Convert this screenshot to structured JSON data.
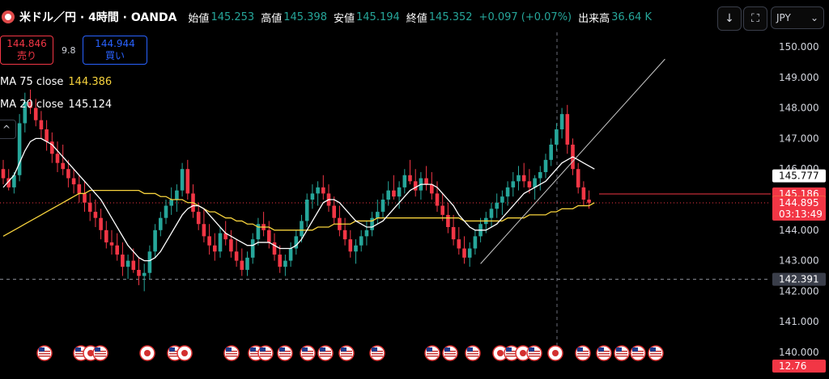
{
  "header": {
    "symbol": "米ドル／円 · 4時間 · OANDA",
    "open_label": "始値",
    "open": "145.253",
    "high_label": "高値",
    "high": "145.398",
    "low_label": "安値",
    "low": "145.194",
    "close_label": "終値",
    "close": "145.352",
    "change": "+0.097 (+0.07%)",
    "volume_label": "出来高",
    "volume": "36.64 K",
    "currency": "JPY",
    "icons": [
      "download-icon",
      "fullscreen-icon",
      "chevron-down-icon"
    ]
  },
  "trade": {
    "sell_price": "144.846",
    "sell_label": "売り",
    "spread": "9.8",
    "buy_price": "144.944",
    "buy_label": "買い"
  },
  "indicators": [
    {
      "name": "MA 75 close",
      "value": "144.386",
      "color": "#f7d33d"
    },
    {
      "name": "MA 20 close",
      "value": "145.124",
      "color": "#ffffff"
    }
  ],
  "colors": {
    "up": "#26a69a",
    "down": "#f23645",
    "ma75": "#f7d33d",
    "ma20": "#ffffff",
    "trend": "#c8c8c8"
  },
  "chart_data": {
    "type": "candlestick",
    "y_ticks": [
      "150.000",
      "149.000",
      "148.000",
      "147.000",
      "146.000",
      "145.000",
      "144.000",
      "143.000",
      "142.000",
      "141.000",
      "140.000"
    ],
    "ylim": [
      139.7,
      150.35
    ],
    "price_labels": [
      {
        "text": "145.777",
        "value": 145.777,
        "bg": "#ffffff",
        "fg": "#000000"
      },
      {
        "text": "145.186",
        "value": 145.186,
        "bg": "#f23645",
        "fg": "#ffffff"
      },
      {
        "text": "144.902",
        "value": 144.902,
        "bg": "#f7d33d",
        "fg": "#000000"
      },
      {
        "text": "144.895",
        "sub": "03:13:49",
        "value": 144.895,
        "bg": "#f23645",
        "fg": "#ffffff"
      },
      {
        "text": "142.391",
        "value": 142.391,
        "bg": "#3a3e4a",
        "fg": "#ffffff"
      },
      {
        "text": "12.76",
        "value": 139.55,
        "bg": "#f23645",
        "fg": "#ffffff"
      }
    ],
    "horizontal_line": 142.391,
    "candles": [
      [
        146.0,
        146.3,
        145.5,
        145.7
      ],
      [
        145.7,
        146.0,
        145.3,
        145.4
      ],
      [
        145.4,
        145.9,
        145.2,
        145.8
      ],
      [
        145.8,
        147.8,
        145.6,
        147.5
      ],
      [
        147.5,
        148.5,
        147.2,
        148.2
      ],
      [
        148.2,
        148.6,
        147.8,
        148.0
      ],
      [
        148.0,
        148.3,
        147.4,
        147.6
      ],
      [
        147.6,
        147.9,
        147.0,
        147.3
      ],
      [
        147.3,
        147.6,
        146.6,
        146.9
      ],
      [
        146.9,
        147.2,
        146.2,
        146.5
      ],
      [
        146.5,
        146.9,
        145.9,
        146.2
      ],
      [
        146.2,
        146.8,
        145.8,
        146.0
      ],
      [
        146.0,
        146.3,
        145.4,
        145.7
      ],
      [
        145.7,
        146.0,
        145.2,
        145.5
      ],
      [
        145.5,
        145.8,
        144.9,
        145.2
      ],
      [
        145.2,
        145.6,
        144.6,
        144.9
      ],
      [
        144.9,
        145.2,
        144.3,
        144.6
      ],
      [
        144.6,
        145.0,
        144.1,
        144.4
      ],
      [
        144.4,
        144.7,
        143.7,
        144.0
      ],
      [
        144.0,
        144.3,
        143.4,
        143.6
      ],
      [
        143.6,
        144.0,
        143.2,
        143.5
      ],
      [
        143.5,
        143.9,
        143.0,
        143.2
      ],
      [
        143.2,
        143.6,
        142.5,
        142.8
      ],
      [
        142.8,
        143.2,
        142.4,
        143.0
      ],
      [
        143.0,
        143.4,
        142.6,
        142.7
      ],
      [
        142.7,
        143.1,
        142.2,
        142.5
      ],
      [
        142.5,
        142.9,
        142.0,
        142.6
      ],
      [
        142.6,
        143.5,
        142.4,
        143.3
      ],
      [
        143.3,
        144.2,
        143.1,
        144.0
      ],
      [
        144.0,
        144.6,
        143.8,
        144.4
      ],
      [
        144.4,
        145.0,
        144.2,
        144.8
      ],
      [
        144.8,
        145.4,
        144.5,
        145.0
      ],
      [
        145.0,
        145.5,
        144.6,
        145.3
      ],
      [
        145.3,
        146.2,
        145.1,
        146.0
      ],
      [
        146.0,
        146.3,
        145.0,
        145.2
      ],
      [
        145.2,
        145.5,
        144.4,
        144.6
      ],
      [
        144.6,
        144.9,
        144.0,
        144.2
      ],
      [
        144.2,
        144.7,
        143.6,
        143.8
      ],
      [
        143.8,
        144.2,
        143.2,
        143.5
      ],
      [
        143.5,
        143.9,
        143.0,
        143.3
      ],
      [
        143.3,
        144.1,
        143.1,
        143.9
      ],
      [
        143.9,
        144.3,
        143.5,
        143.7
      ],
      [
        143.7,
        144.0,
        143.1,
        143.3
      ],
      [
        143.3,
        143.7,
        142.8,
        143.0
      ],
      [
        143.0,
        143.4,
        142.5,
        142.7
      ],
      [
        142.7,
        143.3,
        142.5,
        143.1
      ],
      [
        143.1,
        143.9,
        142.9,
        143.7
      ],
      [
        143.7,
        144.4,
        143.5,
        144.2
      ],
      [
        144.2,
        144.6,
        143.8,
        144.0
      ],
      [
        144.0,
        144.3,
        143.4,
        143.6
      ],
      [
        143.6,
        143.9,
        143.0,
        143.2
      ],
      [
        143.2,
        143.5,
        142.6,
        142.8
      ],
      [
        142.8,
        143.2,
        142.5,
        143.0
      ],
      [
        143.0,
        143.6,
        142.8,
        143.4
      ],
      [
        143.4,
        144.0,
        143.2,
        143.8
      ],
      [
        143.8,
        144.5,
        143.6,
        144.3
      ],
      [
        144.3,
        145.2,
        144.1,
        145.0
      ],
      [
        145.0,
        145.5,
        144.7,
        145.2
      ],
      [
        145.2,
        145.6,
        144.8,
        145.4
      ],
      [
        145.4,
        145.8,
        145.0,
        145.2
      ],
      [
        145.2,
        145.5,
        144.6,
        144.8
      ],
      [
        144.8,
        145.1,
        144.2,
        144.4
      ],
      [
        144.4,
        144.8,
        143.8,
        144.0
      ],
      [
        144.0,
        144.4,
        143.5,
        143.7
      ],
      [
        143.7,
        144.0,
        143.1,
        143.3
      ],
      [
        143.3,
        143.7,
        142.9,
        143.5
      ],
      [
        143.5,
        144.0,
        143.3,
        143.8
      ],
      [
        143.8,
        144.3,
        143.5,
        144.0
      ],
      [
        144.0,
        144.6,
        143.8,
        144.4
      ],
      [
        144.4,
        145.0,
        144.2,
        144.6
      ],
      [
        144.6,
        145.2,
        144.4,
        145.0
      ],
      [
        145.0,
        145.6,
        144.8,
        145.3
      ],
      [
        145.3,
        145.8,
        145.0,
        145.1
      ],
      [
        145.1,
        145.6,
        144.7,
        145.4
      ],
      [
        145.4,
        146.0,
        145.2,
        145.8
      ],
      [
        145.8,
        146.3,
        145.5,
        145.6
      ],
      [
        145.6,
        146.0,
        145.1,
        145.3
      ],
      [
        145.3,
        145.9,
        145.0,
        145.7
      ],
      [
        145.7,
        146.1,
        145.3,
        145.5
      ],
      [
        145.5,
        145.9,
        145.0,
        145.2
      ],
      [
        145.2,
        145.6,
        144.6,
        144.8
      ],
      [
        144.8,
        145.2,
        144.3,
        144.5
      ],
      [
        144.5,
        144.9,
        143.9,
        144.1
      ],
      [
        144.1,
        144.5,
        143.5,
        143.7
      ],
      [
        143.7,
        144.1,
        143.2,
        143.4
      ],
      [
        143.4,
        143.8,
        142.9,
        143.1
      ],
      [
        143.1,
        143.6,
        142.8,
        143.4
      ],
      [
        143.4,
        144.0,
        143.2,
        143.8
      ],
      [
        143.8,
        144.4,
        143.6,
        144.2
      ],
      [
        144.2,
        144.6,
        143.9,
        144.4
      ],
      [
        144.4,
        144.9,
        144.1,
        144.7
      ],
      [
        144.7,
        145.2,
        144.4,
        144.9
      ],
      [
        144.9,
        145.3,
        144.5,
        145.1
      ],
      [
        145.1,
        145.6,
        144.8,
        145.4
      ],
      [
        145.4,
        145.9,
        145.1,
        145.6
      ],
      [
        145.6,
        146.1,
        145.3,
        145.8
      ],
      [
        145.8,
        146.2,
        145.4,
        145.6
      ],
      [
        145.6,
        146.0,
        145.2,
        145.4
      ],
      [
        145.4,
        145.8,
        145.0,
        145.7
      ],
      [
        145.7,
        146.1,
        145.3,
        145.9
      ],
      [
        145.9,
        146.5,
        145.7,
        146.3
      ],
      [
        146.3,
        147.0,
        146.1,
        146.8
      ],
      [
        146.8,
        147.5,
        146.6,
        147.3
      ],
      [
        147.3,
        148.0,
        147.0,
        147.8
      ],
      [
        147.8,
        148.1,
        146.5,
        146.8
      ],
      [
        146.8,
        147.0,
        145.8,
        146.0
      ],
      [
        146.0,
        146.2,
        145.2,
        145.4
      ],
      [
        145.4,
        145.6,
        144.8,
        145.0
      ],
      [
        145.0,
        145.3,
        144.7,
        144.9
      ]
    ],
    "ma20": [
      145.4,
      145.6,
      145.8,
      146.2,
      146.6,
      146.9,
      147.0,
      147.0,
      146.9,
      146.8,
      146.6,
      146.4,
      146.2,
      146.0,
      145.8,
      145.6,
      145.4,
      145.2,
      145.0,
      144.7,
      144.4,
      144.1,
      143.8,
      143.5,
      143.3,
      143.1,
      143.0,
      143.0,
      143.1,
      143.3,
      143.6,
      143.9,
      144.2,
      144.5,
      144.7,
      144.8,
      144.8,
      144.7,
      144.5,
      144.3,
      144.1,
      143.9,
      143.8,
      143.7,
      143.6,
      143.5,
      143.5,
      143.6,
      143.6,
      143.6,
      143.5,
      143.4,
      143.4,
      143.4,
      143.5,
      143.7,
      144.0,
      144.3,
      144.6,
      144.9,
      145.0,
      145.0,
      144.9,
      144.7,
      144.5,
      144.3,
      144.2,
      144.1,
      144.1,
      144.2,
      144.3,
      144.5,
      144.7,
      144.9,
      145.1,
      145.3,
      145.4,
      145.5,
      145.5,
      145.5,
      145.4,
      145.2,
      145.0,
      144.8,
      144.5,
      144.3,
      144.1,
      144.0,
      144.0,
      144.0,
      144.1,
      144.2,
      144.4,
      144.6,
      144.8,
      145.0,
      145.2,
      145.3,
      145.4,
      145.5,
      145.6,
      145.8,
      146.0,
      146.2,
      146.3,
      146.4,
      146.3,
      146.2,
      146.1,
      146.0
    ],
    "ma75": [
      143.8,
      143.9,
      144.0,
      144.1,
      144.2,
      144.3,
      144.4,
      144.5,
      144.6,
      144.7,
      144.8,
      144.9,
      145.0,
      145.1,
      145.2,
      145.2,
      145.3,
      145.3,
      145.3,
      145.3,
      145.3,
      145.3,
      145.3,
      145.3,
      145.3,
      145.3,
      145.2,
      145.2,
      145.2,
      145.1,
      145.1,
      145.0,
      145.0,
      145.0,
      144.9,
      144.9,
      144.8,
      144.7,
      144.6,
      144.6,
      144.5,
      144.4,
      144.4,
      144.3,
      144.3,
      144.2,
      144.2,
      144.1,
      144.1,
      144.1,
      144.0,
      144.0,
      144.0,
      144.0,
      144.0,
      144.0,
      144.0,
      144.0,
      144.1,
      144.1,
      144.1,
      144.2,
      144.2,
      144.2,
      144.2,
      144.3,
      144.3,
      144.3,
      144.3,
      144.4,
      144.4,
      144.4,
      144.4,
      144.4,
      144.4,
      144.4,
      144.4,
      144.4,
      144.4,
      144.4,
      144.4,
      144.4,
      144.4,
      144.4,
      144.4,
      144.3,
      144.3,
      144.3,
      144.3,
      144.3,
      144.3,
      144.3,
      144.3,
      144.4,
      144.4,
      144.4,
      144.4,
      144.5,
      144.5,
      144.5,
      144.5,
      144.6,
      144.6,
      144.7,
      144.7,
      144.7,
      144.8,
      144.8,
      144.8,
      144.9
    ],
    "trendlines": [
      {
        "x1_index": 88,
        "y1": 142.9,
        "x2_index": 122,
        "y2": 149.6
      }
    ],
    "event_markers": [
      "us",
      "us",
      "jp",
      "us",
      "jp",
      "us",
      "jp",
      "us",
      "us",
      "us",
      "us",
      "us",
      "us",
      "us",
      "us",
      "us",
      "us",
      "us",
      "jp",
      "us",
      "jp",
      "us",
      "jp",
      "us",
      "us",
      "us",
      "us",
      "us",
      "us",
      "us"
    ]
  }
}
